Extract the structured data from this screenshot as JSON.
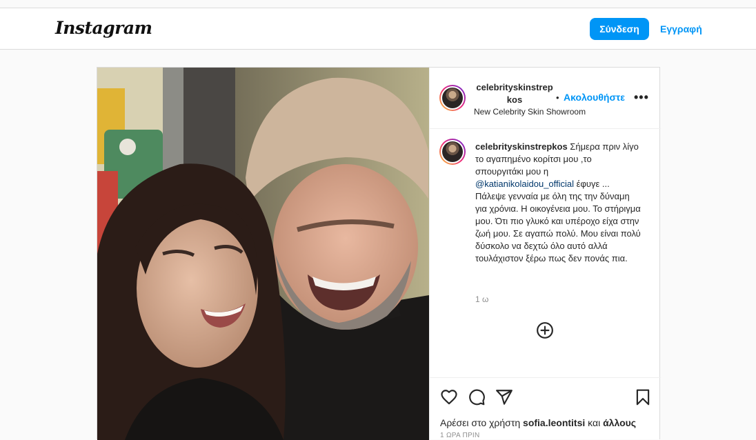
{
  "navbar": {
    "logo": "Instagram",
    "login_label": "Σύνδεση",
    "signup_label": "Εγγραφή"
  },
  "post": {
    "header": {
      "username_line1": "celebrityskinstrep",
      "username_line2": "kos",
      "dot": "•",
      "follow_label": "Ακολουθήστε",
      "more": "•••",
      "location": "New Celebrity Skin Showroom"
    },
    "caption": {
      "username": "celebrityskinstrepkos",
      "text_before": " Σήμερα πριν λίγο το αγαπημένο κορίτσι μου ,το σπουργιτάκι μου η ",
      "mention": "@katianikolaidou_official",
      "text_after": " έφυγε ... Πάλεψε γενναία με όλη της την δύναμη για χρόνια. Η οικογένεια μου. Το στήριγμα μου. Ότι πιο γλυκό και υπέροχο είχα στην ζωή μου. Σε αγαπώ πολύ. Μου είναι πολύ δύσκολο να δεχτώ όλο αυτό αλλά τουλάχιστον ξέρω πως δεν πονάς πια.",
      "time": "1 ω"
    },
    "likes": {
      "prefix": "Αρέσει στο χρήστη ",
      "user": "sofia.leontitsi",
      "middle": " και ",
      "others": "άλλους"
    },
    "posted_ago": "1 ΩΡΑ ΠΡΙΝ"
  },
  "colors": {
    "accent": "#0095f6",
    "border": "#dbdbdb",
    "mention": "#00376b",
    "muted": "#8e8e8e"
  },
  "icons": [
    "plus-circle-icon",
    "heart-icon",
    "comment-icon",
    "share-icon",
    "bookmark-icon",
    "more-icon"
  ]
}
